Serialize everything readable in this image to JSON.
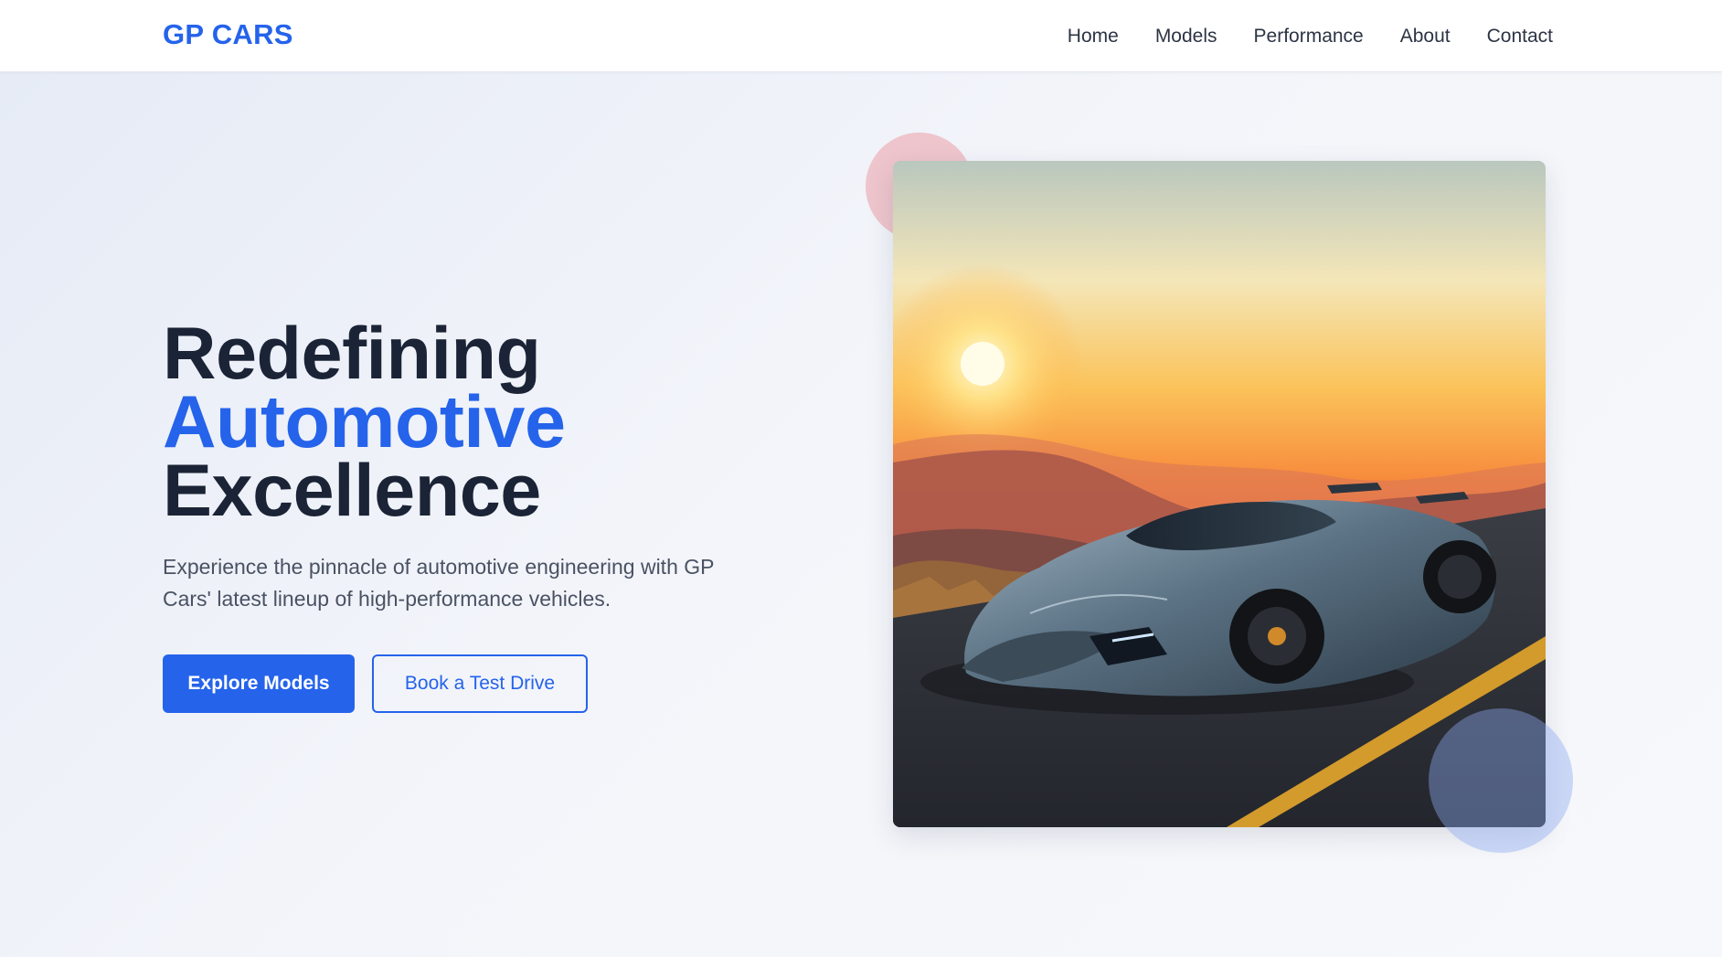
{
  "nav": {
    "logo": "GP CARS",
    "links": [
      "Home",
      "Models",
      "Performance",
      "About",
      "Contact"
    ]
  },
  "hero": {
    "title_line1": "Redefining",
    "title_line2": "Automotive",
    "title_line3": "Excellence",
    "subtitle": "Experience the pinnacle of automotive engineering with GP Cars' latest lineup of high-performance vehicles.",
    "primary_button": "Explore Models",
    "secondary_button": "Book a Test Drive"
  },
  "colors": {
    "accent": "#2563eb",
    "heading": "#1b2436",
    "body_text": "#4a5263"
  }
}
